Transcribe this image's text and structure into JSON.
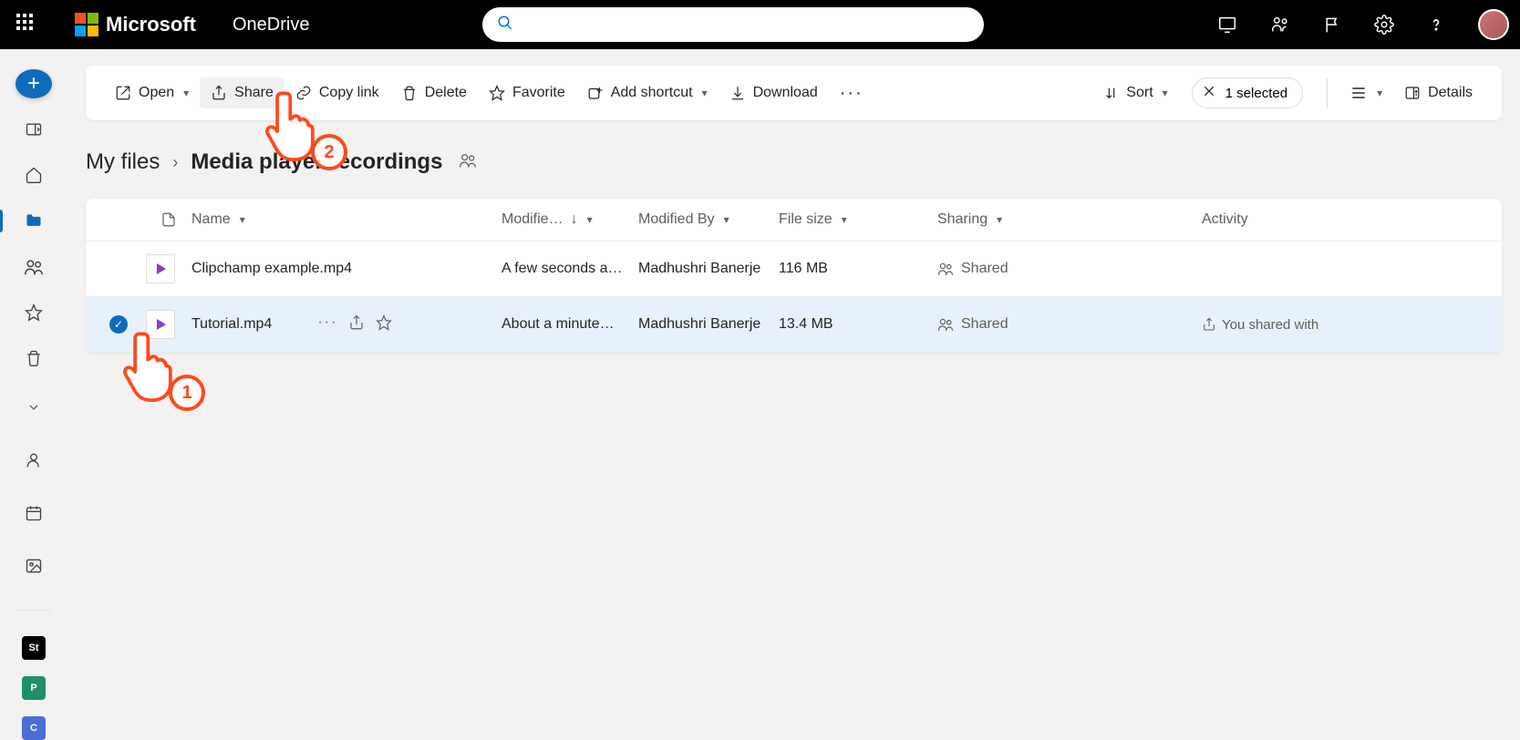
{
  "header": {
    "brand": "Microsoft",
    "app": "OneDrive"
  },
  "toolbar": {
    "open": "Open",
    "share": "Share",
    "copy_link": "Copy link",
    "delete": "Delete",
    "favorite": "Favorite",
    "add_shortcut": "Add shortcut",
    "download": "Download",
    "sort": "Sort",
    "selected": "1 selected",
    "details": "Details"
  },
  "breadcrumbs": {
    "root": "My files",
    "current": "Media player recordings"
  },
  "columns": {
    "name": "Name",
    "modified": "Modifie…",
    "modified_by": "Modified By",
    "file_size": "File size",
    "sharing": "Sharing",
    "activity": "Activity"
  },
  "files": [
    {
      "name": "Clipchamp example.mp4",
      "modified": "A few seconds a…",
      "modified_by": "Madhushri Banerje",
      "size": "116 MB",
      "sharing": "Shared",
      "selected": false
    },
    {
      "name": "Tutorial.mp4",
      "modified": "About a minute…",
      "modified_by": "Madhushri Banerje",
      "size": "13.4 MB",
      "sharing": "Shared",
      "selected": true,
      "activity": "You shared with"
    }
  ],
  "annotations": {
    "one": "1",
    "two": "2"
  }
}
